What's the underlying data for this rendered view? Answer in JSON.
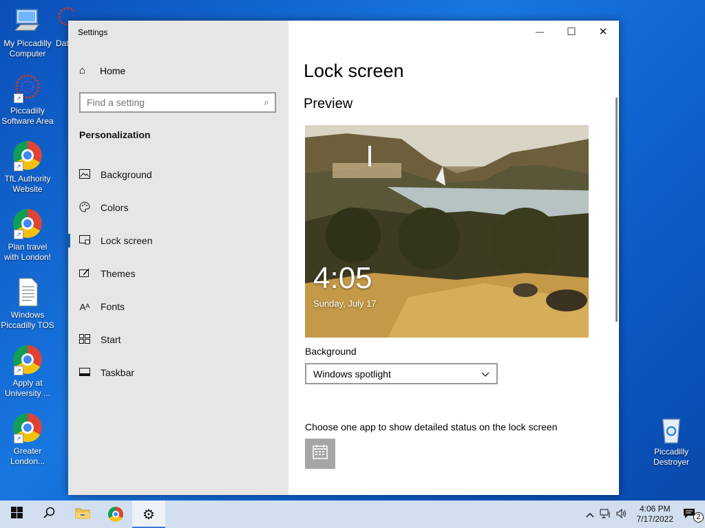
{
  "desktop": {
    "icons": [
      {
        "label": "My Piccadilly Computer",
        "type": "computer"
      },
      {
        "label": "Dat",
        "type": "app"
      },
      {
        "label": "Piccadilly Software Area",
        "type": "app"
      },
      {
        "label": "TfL Authority Website",
        "type": "chrome"
      },
      {
        "label": "Plan travel with London!",
        "type": "chrome"
      },
      {
        "label": "Windows Piccadilly TOS",
        "type": "document"
      },
      {
        "label": "Apply at University ...",
        "type": "chrome"
      },
      {
        "label": "Greater London...",
        "type": "chrome"
      },
      {
        "label": "Piccadilly Destroyer",
        "type": "recycle-bin"
      }
    ]
  },
  "window": {
    "title": "Settings",
    "controls": {
      "minimize": "—",
      "maximize": "☐",
      "close": "✕"
    }
  },
  "sidebar": {
    "home": {
      "label": "Home",
      "icon": "home-icon"
    },
    "search": {
      "placeholder": "Find a setting",
      "icon": "search-icon"
    },
    "section": "Personalization",
    "items": [
      {
        "label": "Background",
        "icon": "picture-icon",
        "glyph": "▭"
      },
      {
        "label": "Colors",
        "icon": "palette-icon",
        "glyph": "◔"
      },
      {
        "label": "Lock screen",
        "icon": "lock-screen-icon",
        "glyph": "▭",
        "active": true
      },
      {
        "label": "Themes",
        "icon": "brush-icon",
        "glyph": "✎"
      },
      {
        "label": "Fonts",
        "icon": "font-icon",
        "glyph": "A"
      },
      {
        "label": "Start",
        "icon": "start-grid-icon",
        "glyph": "▦"
      },
      {
        "label": "Taskbar",
        "icon": "taskbar-icon",
        "glyph": "▬"
      }
    ]
  },
  "content": {
    "title": "Lock screen",
    "preview_heading": "Preview",
    "preview_time": "4:05",
    "preview_date": "Sunday, July 17",
    "background_label": "Background",
    "background_value": "Windows spotlight",
    "detailed_status_label": "Choose one app to show detailed status on the lock screen",
    "detailed_status_app_icon": "calendar-icon"
  },
  "taskbar": {
    "items": [
      {
        "name": "start-button",
        "icon": "windows-icon"
      },
      {
        "name": "search-button",
        "icon": "search-icon"
      },
      {
        "name": "file-explorer-button",
        "icon": "folder-icon"
      },
      {
        "name": "chrome-button",
        "icon": "chrome-icon"
      },
      {
        "name": "settings-button",
        "icon": "gear-icon",
        "active": true
      }
    ],
    "tray": {
      "time": "4:06 PM",
      "date": "7/17/2022",
      "notification_count": "2"
    }
  },
  "colors": {
    "accent": "#0063b1",
    "sidebar_bg": "#e6e6e6",
    "desktop_bg": "#1877e0"
  }
}
